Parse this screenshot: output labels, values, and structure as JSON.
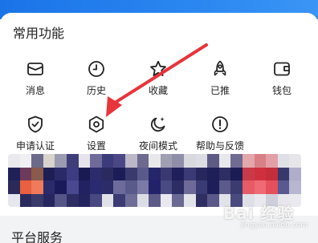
{
  "section": {
    "title": "常用功能"
  },
  "features": [
    {
      "label": "消息",
      "icon": "message-icon"
    },
    {
      "label": "历史",
      "icon": "clock-icon"
    },
    {
      "label": "收藏",
      "icon": "star-icon"
    },
    {
      "label": "已推",
      "icon": "rocket-icon"
    },
    {
      "label": "钱包",
      "icon": "wallet-icon"
    },
    {
      "label": "申请认证",
      "icon": "shield-check-icon"
    },
    {
      "label": "设置",
      "icon": "gear-icon"
    },
    {
      "label": "夜间模式",
      "icon": "moon-icon"
    },
    {
      "label": "帮助与反馈",
      "icon": "help-icon"
    }
  ],
  "bottom_section": {
    "title": "平台服务"
  },
  "watermark": {
    "text": "Bai 经验",
    "sub": "jingyan.baidu.com"
  },
  "colors": {
    "brand_blue": "#1a74e8",
    "annotation_red": "#e8343b",
    "icon_stroke": "#222222"
  }
}
